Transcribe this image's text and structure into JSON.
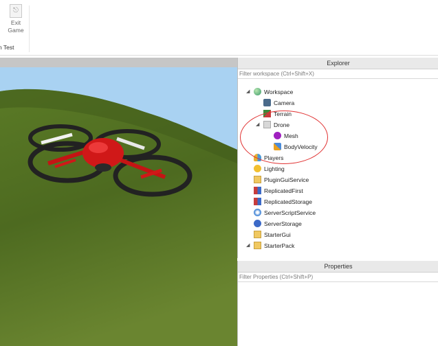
{
  "ribbon": {
    "exit_button_label_line1": "Exit",
    "exit_button_label_line2": "Game",
    "group_label": "n Test"
  },
  "explorer": {
    "title": "Explorer",
    "filter_placeholder": "Filter workspace (Ctrl+Shift+X)",
    "items": [
      {
        "label": "Workspace",
        "icon": "workspace-icon",
        "expanded": true
      },
      {
        "label": "Camera",
        "icon": "camera-icon"
      },
      {
        "label": "Terrain",
        "icon": "terrain-icon"
      },
      {
        "label": "Drone",
        "icon": "model-icon",
        "expanded": true
      },
      {
        "label": "Mesh",
        "icon": "mesh-icon"
      },
      {
        "label": "BodyVelocity",
        "icon": "body-velocity-icon"
      },
      {
        "label": "Players",
        "icon": "players-icon"
      },
      {
        "label": "Lighting",
        "icon": "lighting-icon"
      },
      {
        "label": "PluginGuiService",
        "icon": "folder-icon"
      },
      {
        "label": "ReplicatedFirst",
        "icon": "replicated-icon"
      },
      {
        "label": "ReplicatedStorage",
        "icon": "replicated-icon"
      },
      {
        "label": "ServerScriptService",
        "icon": "script-service-icon"
      },
      {
        "label": "ServerStorage",
        "icon": "storage-icon"
      },
      {
        "label": "StarterGui",
        "icon": "folder-icon"
      },
      {
        "label": "StarterPack",
        "icon": "folder-icon",
        "expanded": true
      }
    ]
  },
  "properties": {
    "title": "Properties",
    "filter_placeholder": "Filter Properties (Ctrl+Shift+P)"
  },
  "colors": {
    "drone_red": "#d01818",
    "drone_black": "#222222",
    "grass": "#4f6b22",
    "sky": "#a9d2f2",
    "annotation_red": "#e03030"
  }
}
